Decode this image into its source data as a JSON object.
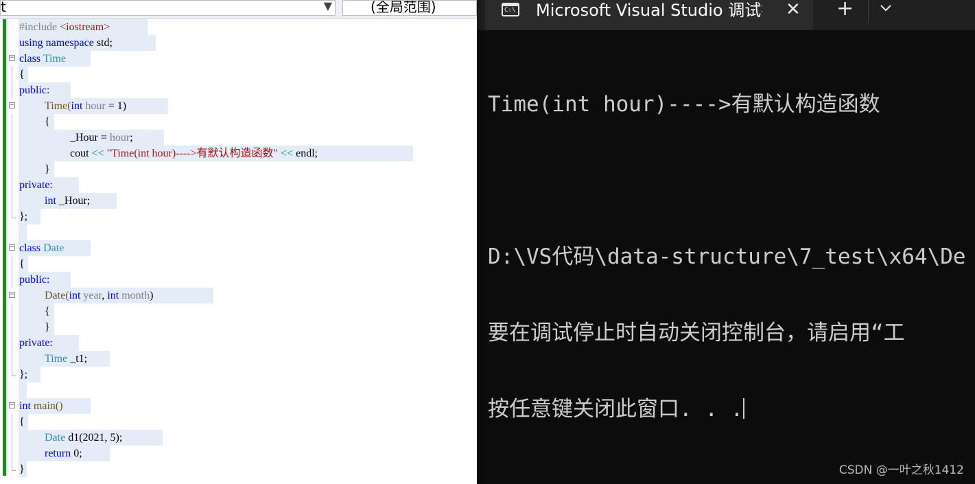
{
  "editor": {
    "member_combo_value": "t",
    "scope_combo_value": "(全局范围)",
    "code": {
      "include_directive": "#include",
      "include_header": "<iostream>",
      "using_kw": "using",
      "namespace_kw": "namespace",
      "std_rest": " std;",
      "class_kw": "class",
      "time_type": "Time",
      "date_type": "Date",
      "brace_open": "{",
      "brace_close": "}",
      "class_end": "};",
      "public_label": "public:",
      "private_label": "private:",
      "int_kw": "int",
      "time_ctor_name": "Time(",
      "hour_param": "hour",
      "default_rest": " = 1)",
      "hour_member": "_Hour",
      "assign_op": " = ",
      "hour_value": "hour",
      "semicolon": ";",
      "cout_name": "cout",
      "stream_op": "<<",
      "string_literal": "\"Time(int hour)---->有默认构造函数\"",
      "endl_rest": "endl;",
      "member_decl": " _Hour;",
      "date_ctor_name": "Date(",
      "year_param": "year",
      "comma_sep": ", ",
      "month_param": "month",
      "close_paren": ")",
      "t1_decl": " _t1;",
      "main_name": "main()",
      "d1_decl": " d1(2021, 5);",
      "return_kw": "return",
      "return_rest": " 0;"
    }
  },
  "console": {
    "tab_icon_text": "C:\\",
    "tab_title": "Microsoft Visual Studio 调试控制台",
    "close_glyph": "✕",
    "new_tab_glyph": "+",
    "output_line": "Time(int hour)---->有默认构造函数",
    "path_line": "D:\\VS代码\\data-structure\\7_test\\x64\\De",
    "hint_line": "要在调试停止时自动关闭控制台，请启用“工",
    "press_key_line": "按任意键关闭此窗口. . ."
  },
  "watermark": "CSDN @一叶之秋1412",
  "colors": {
    "keyword": "#0000ff",
    "type": "#2b91af",
    "string": "#a31515",
    "console_bg": "#0c0c0c",
    "change_bar": "#1d8a1d"
  }
}
